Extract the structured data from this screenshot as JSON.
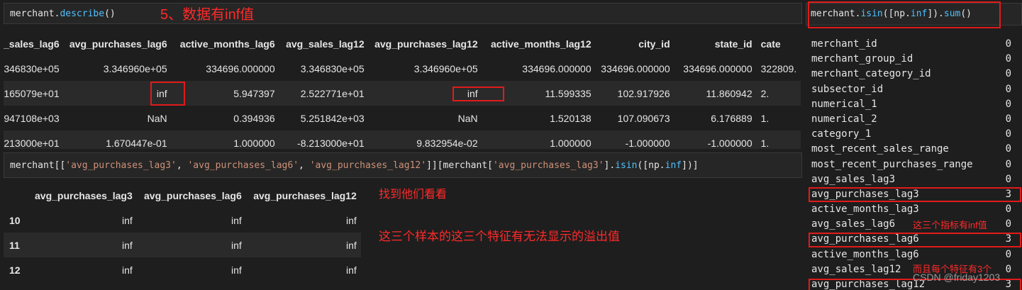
{
  "annotation_title": "5、数据有inf值",
  "cell1": {
    "obj": "merchant",
    "dot": ".",
    "method": "describe",
    "args": "()"
  },
  "describe": {
    "columns": [
      "_sales_lag6",
      "avg_purchases_lag6",
      "active_months_lag6",
      "avg_sales_lag12",
      "avg_purchases_lag12",
      "active_months_lag12",
      "city_id",
      "state_id",
      "cate"
    ],
    "rows": [
      [
        "346830e+05",
        "3.346960e+05",
        "334696.000000",
        "3.346830e+05",
        "3.346960e+05",
        "334696.000000",
        "334696.000000",
        "334696.000000",
        "322809."
      ],
      [
        "165079e+01",
        "inf",
        "5.947397",
        "2.522771e+01",
        "inf",
        "11.599335",
        "102.917926",
        "11.860942",
        "2."
      ],
      [
        "947108e+03",
        "NaN",
        "0.394936",
        "5.251842e+03",
        "NaN",
        "1.520138",
        "107.090673",
        "6.176889",
        "1."
      ],
      [
        "213000e+01",
        "1.670447e-01",
        "1.000000",
        "-8.213000e+01",
        "9.832954e-02",
        "1.000000",
        "-1.000000",
        "-1.000000",
        "1."
      ]
    ]
  },
  "cell2": {
    "p1": "merchant[[",
    "s1": "'avg_purchases_lag3'",
    "c1": ", ",
    "s2": "'avg_purchases_lag6'",
    "c2": ", ",
    "s3": "'avg_purchases_lag12'",
    "p2": "]][merchant[",
    "s4": "'avg_purchases_lag3'",
    "p3": "].",
    "f1": "isin",
    "p4": "([np.",
    "f2": "inf",
    "p5": "])]"
  },
  "result": {
    "columns": [
      "avg_purchases_lag3",
      "avg_purchases_lag6",
      "avg_purchases_lag12"
    ],
    "rows": [
      {
        "index": "10",
        "values": [
          "inf",
          "inf",
          "inf"
        ]
      },
      {
        "index": "11",
        "values": [
          "inf",
          "inf",
          "inf"
        ]
      },
      {
        "index": "12",
        "values": [
          "inf",
          "inf",
          "inf"
        ]
      }
    ]
  },
  "notes": {
    "find": "找到他们看看",
    "overflow": "这三个样本的这三个特征有无法显示的溢出值",
    "three_metrics": "这三个指标有inf值",
    "each_three": "而且每个特征有3个"
  },
  "right": {
    "p1": "merchant.",
    "f1": "isin",
    "p2": "([np.",
    "f2": "inf",
    "p3": "]).",
    "f3": "sum",
    "p4": "()",
    "items": [
      {
        "name": "merchant_id",
        "value": "0"
      },
      {
        "name": "merchant_group_id",
        "value": "0"
      },
      {
        "name": "merchant_category_id",
        "value": "0"
      },
      {
        "name": "subsector_id",
        "value": "0"
      },
      {
        "name": "numerical_1",
        "value": "0"
      },
      {
        "name": "numerical_2",
        "value": "0"
      },
      {
        "name": "category_1",
        "value": "0"
      },
      {
        "name": "most_recent_sales_range",
        "value": "0"
      },
      {
        "name": "most_recent_purchases_range",
        "value": "0"
      },
      {
        "name": "avg_sales_lag3",
        "value": "0"
      },
      {
        "name": "avg_purchases_lag3",
        "value": "3"
      },
      {
        "name": "active_months_lag3",
        "value": "0"
      },
      {
        "name": "avg_sales_lag6",
        "value": "0"
      },
      {
        "name": "avg_purchases_lag6",
        "value": "3"
      },
      {
        "name": "active_months_lag6",
        "value": "0"
      },
      {
        "name": "avg_sales_lag12",
        "value": "0"
      },
      {
        "name": "avg_purchases_lag12",
        "value": "3"
      }
    ]
  },
  "watermark": "CSDN @friday1203",
  "colors": {
    "annotation": "#ff2a2a",
    "box": "#e01b1b",
    "string": "#ce9178",
    "function": "#4fc1ff"
  }
}
